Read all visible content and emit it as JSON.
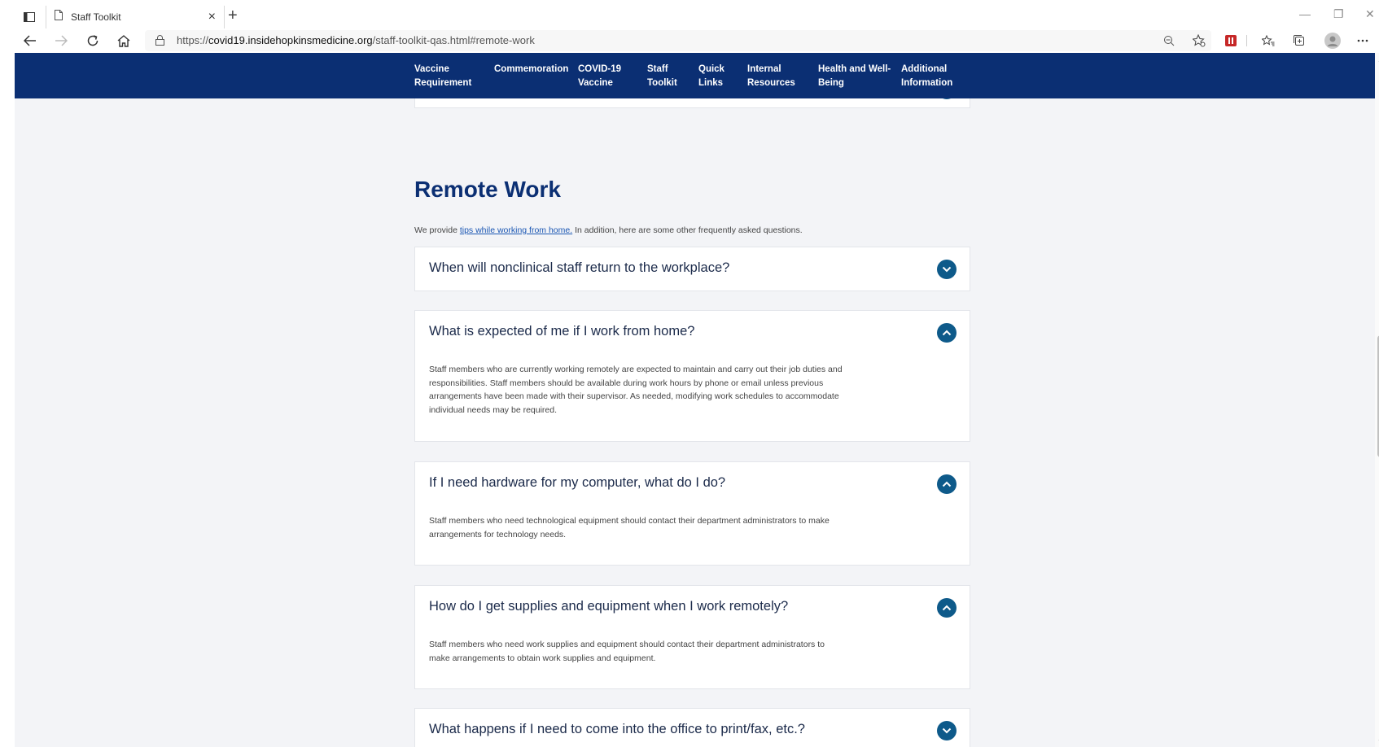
{
  "browser": {
    "tab_title": "Staff Toolkit",
    "tab_close": "×",
    "new_tab": "+",
    "url_prefix": "https://",
    "url_host": "covid19.insidehopkinsmedicine.org",
    "url_path": "/staff-toolkit-qas.html#remote-work",
    "window_minimize": "—",
    "window_restore": "❐",
    "window_close": "✕"
  },
  "site_nav": {
    "items": [
      {
        "line1": "Vaccine",
        "line2": "Requirement"
      },
      {
        "line1": "Commemoration",
        "line2": ""
      },
      {
        "line1": "COVID-19",
        "line2": "Vaccine"
      },
      {
        "line1": "Staff",
        "line2": "Toolkit"
      },
      {
        "line1": "Quick",
        "line2": "Links"
      },
      {
        "line1": "Internal",
        "line2": "Resources"
      },
      {
        "line1": "Health and Well-",
        "line2": "Being"
      },
      {
        "line1": "Additional",
        "line2": "Information"
      }
    ]
  },
  "section": {
    "title": "Remote Work",
    "intro_before": "We provide ",
    "intro_link": "tips while working from home.",
    "intro_after": " In addition, here are some other frequently asked questions."
  },
  "faqs": [
    {
      "question": "When will nonclinical staff return to the workplace?",
      "expanded": false,
      "answer": ""
    },
    {
      "question": "What is expected of me if I work from home?",
      "expanded": true,
      "answer": "Staff members who are currently working remotely are expected to maintain and carry out their job duties and responsibilities. Staff members should be available during work hours by phone or email unless previous arrangements have been made with their supervisor. As needed, modifying work schedules to accommodate individual needs may be required."
    },
    {
      "question": "If I need hardware for my computer, what do I do?",
      "expanded": true,
      "answer": "Staff members who need technological equipment should contact their department administrators to make arrangements for technology needs."
    },
    {
      "question": "How do I get supplies and equipment when I work remotely?",
      "expanded": true,
      "answer": "Staff members who need work supplies and equipment should contact their department administrators to make arrangements to obtain work supplies and equipment."
    },
    {
      "question": "What happens if I need to come into the office to print/fax, etc.?",
      "expanded": false,
      "answer": ""
    }
  ],
  "colors": {
    "nav_bg": "#0b2f73",
    "accent": "#0e5a8a",
    "page_bg": "#f3f4f7"
  }
}
